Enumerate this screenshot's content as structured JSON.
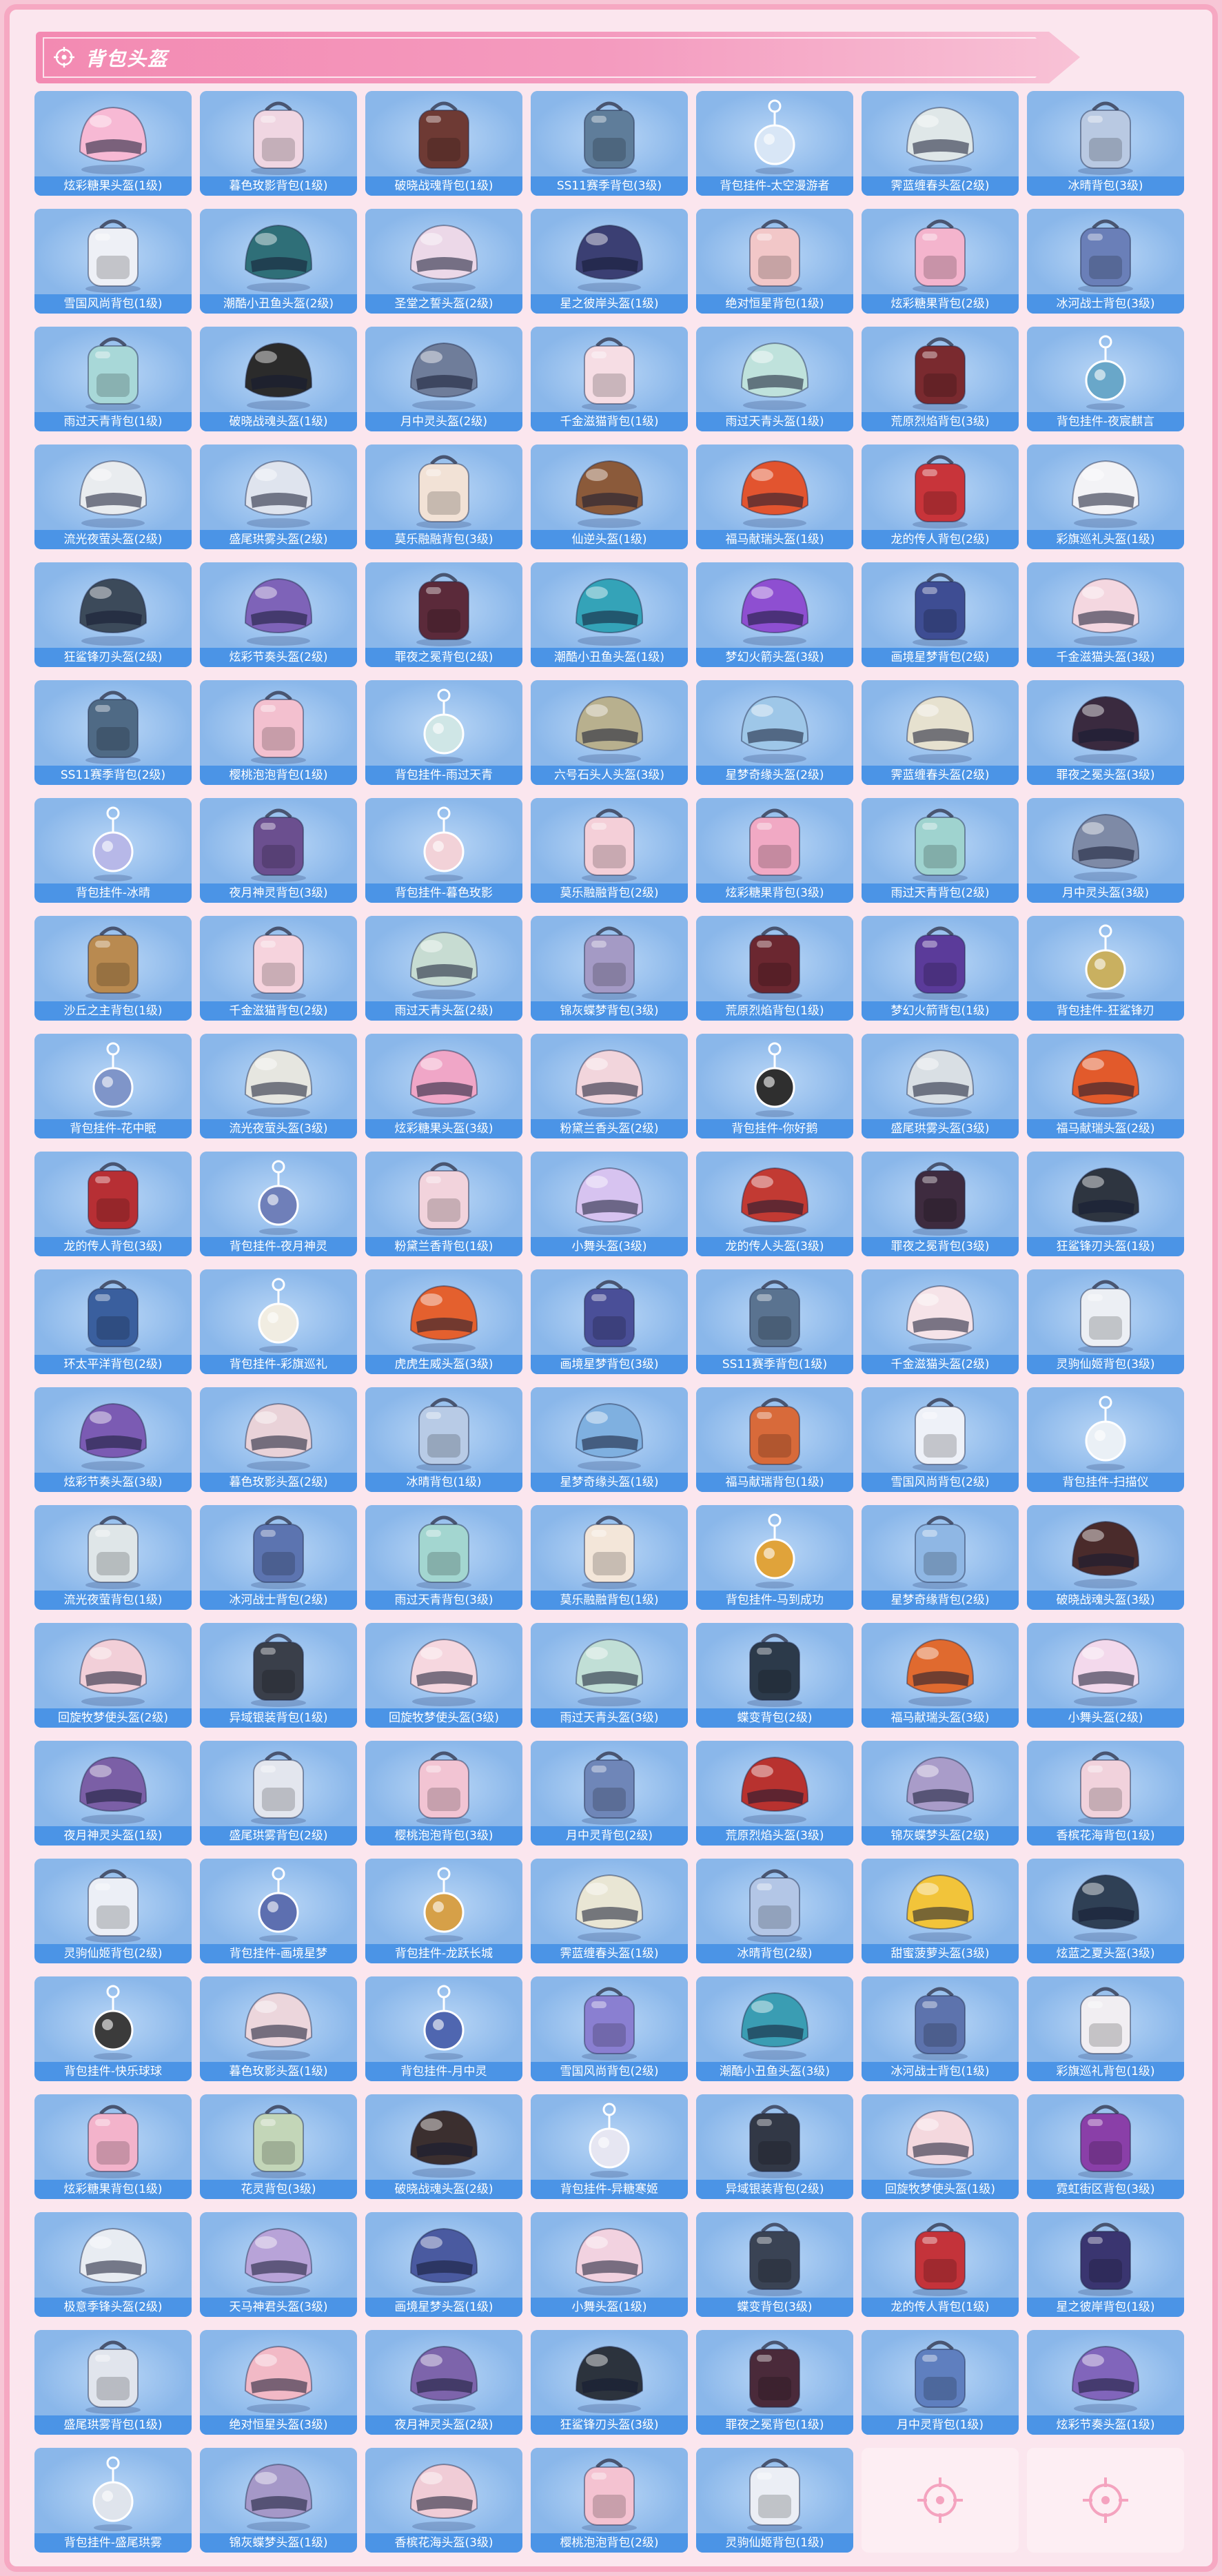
{
  "section": {
    "title": "背包头盔",
    "icon": "crosshair-icon"
  },
  "colors": {
    "page_bg": "#f7c6d6",
    "header_pink": "#f38ab2",
    "cell_blue": "#8ab7ea",
    "label_blue": "#4b94e6",
    "empty_cell": "#fdeef3"
  },
  "items": [
    {
      "name": "炫彩糖果头盔(1级)",
      "type": "helmet",
      "color": "#f7b9d4"
    },
    {
      "name": "暮色玫影背包(1级)",
      "type": "backpack",
      "color": "#f0d6e2"
    },
    {
      "name": "破晓战魂背包(1级)",
      "type": "backpack",
      "color": "#6e3a34"
    },
    {
      "name": "SS11赛季背包(3级)",
      "type": "backpack",
      "color": "#5f7d9a"
    },
    {
      "name": "背包挂件-太空漫游者",
      "type": "charm",
      "color": "#d8e6f6"
    },
    {
      "name": "霁蓝缠春头盔(2级)",
      "type": "helmet",
      "color": "#dfe7e8"
    },
    {
      "name": "冰晴背包(3级)",
      "type": "backpack",
      "color": "#b9c9e2"
    },
    {
      "name": "雪国风尚背包(1级)",
      "type": "backpack",
      "color": "#eef0f6"
    },
    {
      "name": "潮酷小丑鱼头盔(2级)",
      "type": "helmet",
      "color": "#2f6f78"
    },
    {
      "name": "圣堂之誓头盔(2级)",
      "type": "helmet",
      "color": "#ecd8e8"
    },
    {
      "name": "星之彼岸头盔(1级)",
      "type": "helmet",
      "color": "#3b3f73"
    },
    {
      "name": "绝对恒星背包(1级)",
      "type": "backpack",
      "color": "#f2c7c8"
    },
    {
      "name": "炫彩糖果背包(2级)",
      "type": "backpack",
      "color": "#f4b4cd"
    },
    {
      "name": "冰河战士背包(3级)",
      "type": "backpack",
      "color": "#6a7fb8"
    },
    {
      "name": "雨过天青背包(1级)",
      "type": "backpack",
      "color": "#a8d8d8"
    },
    {
      "name": "破晓战魂头盔(1级)",
      "type": "helmet",
      "color": "#2b2b2b"
    },
    {
      "name": "月中灵头盔(2级)",
      "type": "helmet",
      "color": "#6f7d9a"
    },
    {
      "name": "千金滋猫背包(1级)",
      "type": "backpack",
      "color": "#f6dde4"
    },
    {
      "name": "雨过天青头盔(1级)",
      "type": "helmet",
      "color": "#bfe2dc"
    },
    {
      "name": "荒原烈焰背包(3级)",
      "type": "backpack",
      "color": "#7a2a2f"
    },
    {
      "name": "背包挂件-夜宸麒言",
      "type": "charm",
      "color": "#69a7c9"
    },
    {
      "name": "流光夜萤头盔(2级)",
      "type": "helmet",
      "color": "#e9ecef"
    },
    {
      "name": "盛尾珙雾头盔(2级)",
      "type": "helmet",
      "color": "#dfe4ee"
    },
    {
      "name": "莫乐融融背包(3级)",
      "type": "backpack",
      "color": "#f2e2d6"
    },
    {
      "name": "仙逆头盔(1级)",
      "type": "helmet",
      "color": "#8b5a3a"
    },
    {
      "name": "福马献瑞头盔(1级)",
      "type": "helmet",
      "color": "#e2542f"
    },
    {
      "name": "龙的传人背包(2级)",
      "type": "backpack",
      "color": "#c8343a"
    },
    {
      "name": "彩旗巡礼头盔(1级)",
      "type": "helmet",
      "color": "#f3f3f6"
    },
    {
      "name": "狂鲨锋刃头盔(2级)",
      "type": "helmet",
      "color": "#3c4a5a"
    },
    {
      "name": "炫彩节奏头盔(2级)",
      "type": "helmet",
      "color": "#7e63b8"
    },
    {
      "name": "罪夜之冕背包(2级)",
      "type": "backpack",
      "color": "#5b2a3a"
    },
    {
      "name": "潮酷小丑鱼头盔(1级)",
      "type": "helmet",
      "color": "#34a3b8"
    },
    {
      "name": "梦幻火箭头盔(3级)",
      "type": "helmet",
      "color": "#8e4fd1"
    },
    {
      "name": "画境星梦背包(2级)",
      "type": "backpack",
      "color": "#3e4d93"
    },
    {
      "name": "千金滋猫头盔(3级)",
      "type": "helmet",
      "color": "#f4d7e0"
    },
    {
      "name": "SS11赛季背包(2级)",
      "type": "backpack",
      "color": "#4f6a85"
    },
    {
      "name": "樱桃泡泡背包(1级)",
      "type": "backpack",
      "color": "#f3c0cf"
    },
    {
      "name": "背包挂件-雨过天青",
      "type": "charm",
      "color": "#cfe6e6"
    },
    {
      "name": "六号石头人头盔(3级)",
      "type": "helmet",
      "color": "#b8b08e"
    },
    {
      "name": "星梦奇缘头盔(2级)",
      "type": "helmet",
      "color": "#9ec7e8"
    },
    {
      "name": "霁蓝缠春头盔(2级)",
      "type": "helmet",
      "color": "#e6e1cf"
    },
    {
      "name": "罪夜之冕头盔(3级)",
      "type": "helmet",
      "color": "#3a2a3f"
    },
    {
      "name": "背包挂件-冰晴",
      "type": "charm",
      "color": "#b7b8e8"
    },
    {
      "name": "夜月神灵背包(3级)",
      "type": "backpack",
      "color": "#6b4f8f"
    },
    {
      "name": "背包挂件-暮色玫影",
      "type": "charm",
      "color": "#f2d2d8"
    },
    {
      "name": "莫乐融融背包(2级)",
      "type": "backpack",
      "color": "#f4cfd8"
    },
    {
      "name": "炫彩糖果背包(3级)",
      "type": "backpack",
      "color": "#f1a9c4"
    },
    {
      "name": "雨过天青背包(2级)",
      "type": "backpack",
      "color": "#9fd3cf"
    },
    {
      "name": "月中灵头盔(3级)",
      "type": "helmet",
      "color": "#7e8aa6"
    },
    {
      "name": "沙丘之主背包(1级)",
      "type": "backpack",
      "color": "#b98a50"
    },
    {
      "name": "千金滋猫背包(2级)",
      "type": "backpack",
      "color": "#f6d3dd"
    },
    {
      "name": "雨过天青头盔(2级)",
      "type": "helmet",
      "color": "#c7dcd2"
    },
    {
      "name": "锦灰蝶梦背包(3级)",
      "type": "backpack",
      "color": "#a49ac5"
    },
    {
      "name": "荒原烈焰背包(1级)",
      "type": "backpack",
      "color": "#6b2730"
    },
    {
      "name": "梦幻火箭背包(1级)",
      "type": "backpack",
      "color": "#5b3b9a"
    },
    {
      "name": "背包挂件-狂鲨锋刃",
      "type": "charm",
      "color": "#c9b060"
    },
    {
      "name": "背包挂件-花中眠",
      "type": "charm",
      "color": "#7f95c9"
    },
    {
      "name": "流光夜萤头盔(3级)",
      "type": "helmet",
      "color": "#e6e6e0"
    },
    {
      "name": "炫彩糖果头盔(3级)",
      "type": "helmet",
      "color": "#f0a6c7"
    },
    {
      "name": "粉黛兰香头盔(2级)",
      "type": "helmet",
      "color": "#f2d5dc"
    },
    {
      "name": "背包挂件-你好鹅",
      "type": "charm",
      "color": "#2f2f2f"
    },
    {
      "name": "盛尾珙雾头盔(3级)",
      "type": "helmet",
      "color": "#d9dfe4"
    },
    {
      "name": "福马献瑞头盔(2级)",
      "type": "helmet",
      "color": "#e25a2b"
    },
    {
      "name": "龙的传人背包(3级)",
      "type": "backpack",
      "color": "#b72f34"
    },
    {
      "name": "背包挂件-夜月神灵",
      "type": "charm",
      "color": "#6f7fb9"
    },
    {
      "name": "粉黛兰香背包(1级)",
      "type": "backpack",
      "color": "#f2d3dc"
    },
    {
      "name": "小舞头盔(3级)",
      "type": "helmet",
      "color": "#d7c3f0"
    },
    {
      "name": "龙的传人头盔(3级)",
      "type": "helmet",
      "color": "#c23a33"
    },
    {
      "name": "罪夜之冕背包(3级)",
      "type": "backpack",
      "color": "#3e2b3f"
    },
    {
      "name": "狂鲨锋刃头盔(1级)",
      "type": "helmet",
      "color": "#2e3540"
    },
    {
      "name": "环太平洋背包(2级)",
      "type": "backpack",
      "color": "#3a5f9e"
    },
    {
      "name": "背包挂件-彩旗巡礼",
      "type": "charm",
      "color": "#f1ede2"
    },
    {
      "name": "虎虎生威头盔(3级)",
      "type": "helmet",
      "color": "#e4602e"
    },
    {
      "name": "画境星梦背包(3级)",
      "type": "backpack",
      "color": "#4a4f98"
    },
    {
      "name": "SS11赛季背包(1级)",
      "type": "backpack",
      "color": "#5a7390"
    },
    {
      "name": "千金滋猫头盔(2级)",
      "type": "helmet",
      "color": "#f6e3e8"
    },
    {
      "name": "灵驹仙姬背包(3级)",
      "type": "backpack",
      "color": "#eceff4"
    },
    {
      "name": "炫彩节奏头盔(3级)",
      "type": "helmet",
      "color": "#7b5bb3"
    },
    {
      "name": "暮色玫影头盔(2级)",
      "type": "helmet",
      "color": "#e9d2d8"
    },
    {
      "name": "冰晴背包(1级)",
      "type": "backpack",
      "color": "#b8cbe6"
    },
    {
      "name": "星梦奇缘头盔(1级)",
      "type": "helmet",
      "color": "#7fb0e0"
    },
    {
      "name": "福马献瑞背包(1级)",
      "type": "backpack",
      "color": "#d86a3a"
    },
    {
      "name": "雪国风尚背包(2级)",
      "type": "backpack",
      "color": "#eef1f8"
    },
    {
      "name": "背包挂件-扫描仪",
      "type": "charm",
      "color": "#eaf0f6"
    },
    {
      "name": "流光夜萤背包(1级)",
      "type": "backpack",
      "color": "#dfe6e8"
    },
    {
      "name": "冰河战士背包(2级)",
      "type": "backpack",
      "color": "#5c74b0"
    },
    {
      "name": "雨过天青背包(3级)",
      "type": "backpack",
      "color": "#a3d6d0"
    },
    {
      "name": "莫乐融融背包(1级)",
      "type": "backpack",
      "color": "#f3e6d9"
    },
    {
      "name": "背包挂件-马到成功",
      "type": "charm",
      "color": "#e0a33a"
    },
    {
      "name": "星梦奇缘背包(2级)",
      "type": "backpack",
      "color": "#8fb7e4"
    },
    {
      "name": "破晓战魂头盔(3级)",
      "type": "helmet",
      "color": "#4a2b2b"
    },
    {
      "name": "回旋牧梦使头盔(2级)",
      "type": "helmet",
      "color": "#f2cfd8"
    },
    {
      "name": "异域银装背包(1级)",
      "type": "backpack",
      "color": "#3a3f4a"
    },
    {
      "name": "回旋牧梦使头盔(3级)",
      "type": "helmet",
      "color": "#f6d7df"
    },
    {
      "name": "雨过天青头盔(3级)",
      "type": "helmet",
      "color": "#c1dfd6"
    },
    {
      "name": "蝶变背包(2级)",
      "type": "backpack",
      "color": "#2c3a4a"
    },
    {
      "name": "福马献瑞头盔(3级)",
      "type": "helmet",
      "color": "#e06a2f"
    },
    {
      "name": "小舞头盔(2级)",
      "type": "helmet",
      "color": "#f3d9ec"
    },
    {
      "name": "夜月神灵头盔(1级)",
      "type": "helmet",
      "color": "#7b5fa6"
    },
    {
      "name": "盛尾珙雾背包(2级)",
      "type": "backpack",
      "color": "#e3e6ee"
    },
    {
      "name": "樱桃泡泡背包(3级)",
      "type": "backpack",
      "color": "#f2c4d3"
    },
    {
      "name": "月中灵背包(2级)",
      "type": "backpack",
      "color": "#6f86b8"
    },
    {
      "name": "荒原烈焰头盔(3级)",
      "type": "helmet",
      "color": "#b8322f"
    },
    {
      "name": "锦灰蝶梦头盔(2级)",
      "type": "helmet",
      "color": "#a99cc9"
    },
    {
      "name": "香槟花海背包(1级)",
      "type": "backpack",
      "color": "#f1d2dc"
    },
    {
      "name": "灵驹仙姬背包(2级)",
      "type": "backpack",
      "color": "#eceff6"
    },
    {
      "name": "背包挂件-画境星梦",
      "type": "charm",
      "color": "#5d6fb0"
    },
    {
      "name": "背包挂件-龙跃长城",
      "type": "charm",
      "color": "#d6a048"
    },
    {
      "name": "霁蓝缠春头盔(1级)",
      "type": "helmet",
      "color": "#e9e6d4"
    },
    {
      "name": "冰晴背包(2级)",
      "type": "backpack",
      "color": "#b3c6e6"
    },
    {
      "name": "甜蜜菠萝头盔(3级)",
      "type": "helmet",
      "color": "#f2c43a"
    },
    {
      "name": "炫蓝之夏头盔(3级)",
      "type": "helmet",
      "color": "#2f4055"
    },
    {
      "name": "背包挂件-快乐球球",
      "type": "charm",
      "color": "#3b3b3b"
    },
    {
      "name": "暮色玫影头盔(1级)",
      "type": "helmet",
      "color": "#ecd6dc"
    },
    {
      "name": "背包挂件-月中灵",
      "type": "charm",
      "color": "#4f66b0"
    },
    {
      "name": "雪国风尚背包(2级)",
      "type": "backpack",
      "color": "#8a7fd1"
    },
    {
      "name": "潮酷小丑鱼头盔(3级)",
      "type": "helmet",
      "color": "#3a9db3"
    },
    {
      "name": "冰河战士背包(1级)",
      "type": "backpack",
      "color": "#5d73ad"
    },
    {
      "name": "彩旗巡礼背包(1级)",
      "type": "backpack",
      "color": "#f1eef2"
    },
    {
      "name": "炫彩糖果背包(1级)",
      "type": "backpack",
      "color": "#f3b3cb"
    },
    {
      "name": "花灵背包(3级)",
      "type": "backpack",
      "color": "#c3d6b8"
    },
    {
      "name": "破晓战魂头盔(2级)",
      "type": "helmet",
      "color": "#3b2f2f"
    },
    {
      "name": "背包挂件-异糖寒姬",
      "type": "charm",
      "color": "#e6e6f2"
    },
    {
      "name": "异域银装背包(2级)",
      "type": "backpack",
      "color": "#323846"
    },
    {
      "name": "回旋牧梦使头盔(1级)",
      "type": "helmet",
      "color": "#f4d8de"
    },
    {
      "name": "霓虹街区背包(3级)",
      "type": "backpack",
      "color": "#8a3fa8"
    },
    {
      "name": "极意季锋头盔(2级)",
      "type": "helmet",
      "color": "#e8ecf2"
    },
    {
      "name": "天马神君头盔(3级)",
      "type": "helmet",
      "color": "#b8a3d8"
    },
    {
      "name": "画境星梦头盔(1级)",
      "type": "helmet",
      "color": "#4a5aa0"
    },
    {
      "name": "小舞头盔(1级)",
      "type": "helmet",
      "color": "#f2d2e0"
    },
    {
      "name": "蝶变背包(3级)",
      "type": "backpack",
      "color": "#3a4354"
    },
    {
      "name": "龙的传人背包(1级)",
      "type": "backpack",
      "color": "#c4333a"
    },
    {
      "name": "星之彼岸背包(1级)",
      "type": "backpack",
      "color": "#3a3570"
    },
    {
      "name": "盛尾珙雾背包(1级)",
      "type": "backpack",
      "color": "#e1e5ed"
    },
    {
      "name": "绝对恒星头盔(3级)",
      "type": "helmet",
      "color": "#f2b9c6"
    },
    {
      "name": "夜月神灵头盔(2级)",
      "type": "helmet",
      "color": "#7d64ab"
    },
    {
      "name": "狂鲨锋刃头盔(3级)",
      "type": "helmet",
      "color": "#2c333d"
    },
    {
      "name": "罪夜之冕背包(1级)",
      "type": "backpack",
      "color": "#4a2a3a"
    },
    {
      "name": "月中灵背包(1级)",
      "type": "backpack",
      "color": "#5f7fbf"
    },
    {
      "name": "炫彩节奏头盔(1级)",
      "type": "helmet",
      "color": "#8165bb"
    },
    {
      "name": "背包挂件-盛尾珙雾",
      "type": "charm",
      "color": "#dfe4ec"
    },
    {
      "name": "锦灰蝶梦头盔(1级)",
      "type": "helmet",
      "color": "#a598c8"
    },
    {
      "name": "香槟花海头盔(3级)",
      "type": "helmet",
      "color": "#f0ccd6"
    },
    {
      "name": "樱桃泡泡背包(2级)",
      "type": "backpack",
      "color": "#f4c2d1"
    },
    {
      "name": "灵驹仙姬背包(1级)",
      "type": "backpack",
      "color": "#ebeef5"
    }
  ],
  "empty_slots": [
    {
      "icon": "crosshair-icon"
    },
    {
      "icon": "crosshair-icon"
    }
  ]
}
